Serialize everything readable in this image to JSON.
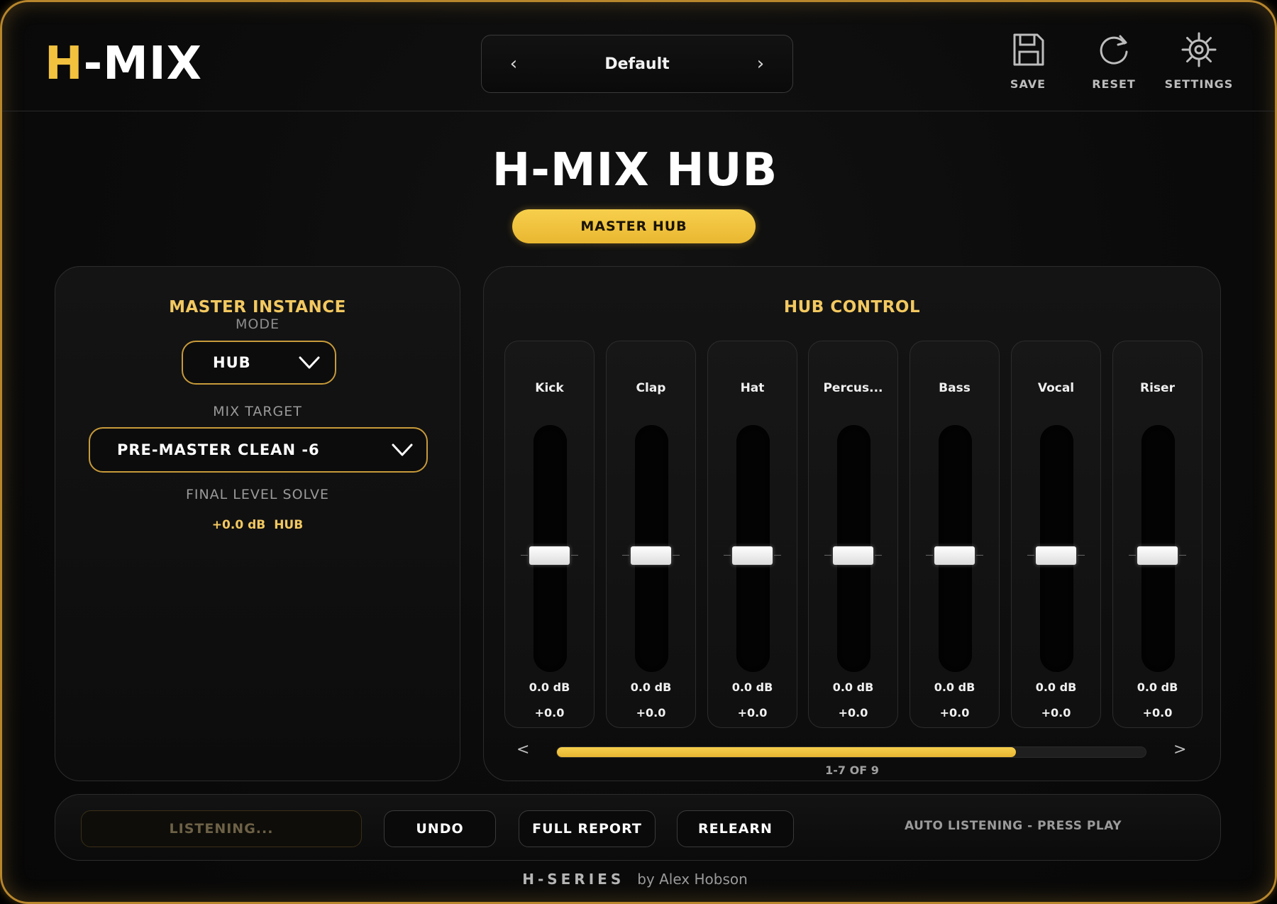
{
  "header": {
    "logo_accent": "H",
    "logo_rest": "-MIX",
    "preset": {
      "prev": "‹",
      "name": "Default",
      "next": "›"
    },
    "actions": [
      {
        "label": "SAVE",
        "icon": "save-icon"
      },
      {
        "label": "RESET",
        "icon": "reset-icon"
      },
      {
        "label": "SETTINGS",
        "icon": "settings-gear-icon"
      }
    ]
  },
  "title": "H-MIX HUB",
  "master_hub_button": "MASTER HUB",
  "master_instance": {
    "heading": "MASTER INSTANCE",
    "mode_label": "MODE",
    "mode_value": "HUB",
    "mix_target_label": "MIX TARGET",
    "mix_target_value": "PRE-MASTER CLEAN -6",
    "final_level_label": "FINAL LEVEL SOLVE",
    "final_level_db": "+0.0 dB",
    "final_level_tag": "HUB"
  },
  "hub_control": {
    "heading": "HUB CONTROL",
    "channels": [
      {
        "name": "Kick",
        "db": "0.0 dB",
        "offset": "+0.0",
        "level": 0.5
      },
      {
        "name": "Clap",
        "db": "0.0 dB",
        "offset": "+0.0",
        "level": 0.5
      },
      {
        "name": "Hat",
        "db": "0.0 dB",
        "offset": "+0.0",
        "level": 0.5
      },
      {
        "name": "Percus...",
        "db": "0.0 dB",
        "offset": "+0.0",
        "level": 0.5
      },
      {
        "name": "Bass",
        "db": "0.0 dB",
        "offset": "+0.0",
        "level": 0.5
      },
      {
        "name": "Vocal",
        "db": "0.0 dB",
        "offset": "+0.0",
        "level": 0.5
      },
      {
        "name": "Riser",
        "db": "0.0 dB",
        "offset": "+0.0",
        "level": 0.5
      }
    ],
    "scroll_prev": "<",
    "scroll_next": ">",
    "scroll_fraction": 0.78,
    "page_indicator": "1-7 OF 9"
  },
  "bottom_bar": {
    "listening": "LISTENING...",
    "undo": "UNDO",
    "full_report": "FULL REPORT",
    "relearn": "RELEARN",
    "status": "AUTO LISTENING - PRESS PLAY"
  },
  "footer": {
    "series": "H-SERIES",
    "author": "by Alex Hobson"
  },
  "colors": {
    "accent": "#f2c23f",
    "accent_text": "#f2c860",
    "background": "#0b0b0b",
    "border_gold": "#c79a3a"
  }
}
